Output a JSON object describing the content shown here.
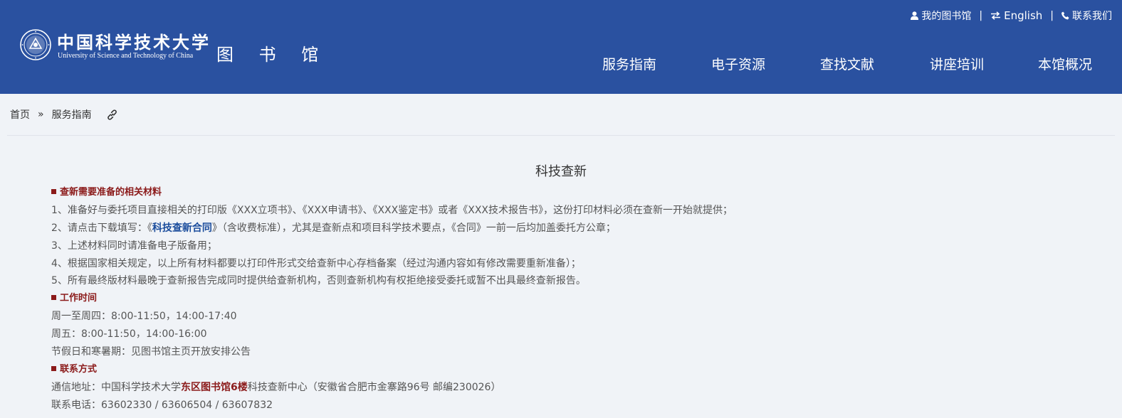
{
  "header": {
    "logo_cn": "中国科学技术大学",
    "logo_en": "University of Science and Technology of China",
    "library": "图 书 馆",
    "top_links": {
      "my_library": "我的图书馆",
      "english": "English",
      "contact": "联系我们",
      "separator": "|"
    },
    "nav": [
      "服务指南",
      "电子资源",
      "查找文献",
      "讲座培训",
      "本馆概况"
    ]
  },
  "breadcrumb": {
    "home": "首页",
    "separator": "»",
    "current": "服务指南"
  },
  "article": {
    "title": "科技查新",
    "sections": {
      "materials": {
        "heading": "查新需要准备的相关材料",
        "item1": "1、准备好与委托项目直接相关的打印版《XXX立项书》、《XXX申请书》、《XXX鉴定书》或者《XXX技术报告书》，这份打印材料必须在查新一开始就提供；",
        "item2_pre": "2、请点击下载填写：《",
        "item2_link": "科技查新合同",
        "item2_post": "》（含收费标准），尤其是查新点和项目科学技术要点，《合同》一前一后均加盖委托方公章；",
        "item3": "3、上述材料同时请准备电子版备用；",
        "item4": "4、根据国家相关规定，以上所有材料都要以打印件形式交给查新中心存档备案（经过沟通内容如有修改需要重新准备）；",
        "item5": "5、所有最终版材料最晚于查新报告完成同时提供给查新机构，否则查新机构有权拒绝接受委托或暂不出具最终查新报告。"
      },
      "hours": {
        "heading": "工作时间",
        "line1": "周一至周四：8:00-11:50，14:00-17:40",
        "line2": "周五：8:00-11:50，14:00-16:00",
        "line3": "节假日和寒暑期：见图书馆主页开放安排公告"
      },
      "contact": {
        "heading": "联系方式",
        "address_pre": "通信地址：中国科学技术大学",
        "address_hl": "东区图书馆6楼",
        "address_post": "科技查新中心（安徽省合肥市金寨路96号 邮编230026）",
        "phone": "联系电话：63602330 / 63606504 / 63607832"
      }
    }
  },
  "colors": {
    "header_bg": "#2a51a0",
    "page_bg": "#f0f3f7",
    "section_heading": "#8b1a1a",
    "link": "#1a4c9c",
    "body_text": "#555555"
  },
  "icons": [
    "university-seal-icon",
    "user-icon",
    "swap-icon",
    "phone-icon",
    "link-icon"
  ]
}
